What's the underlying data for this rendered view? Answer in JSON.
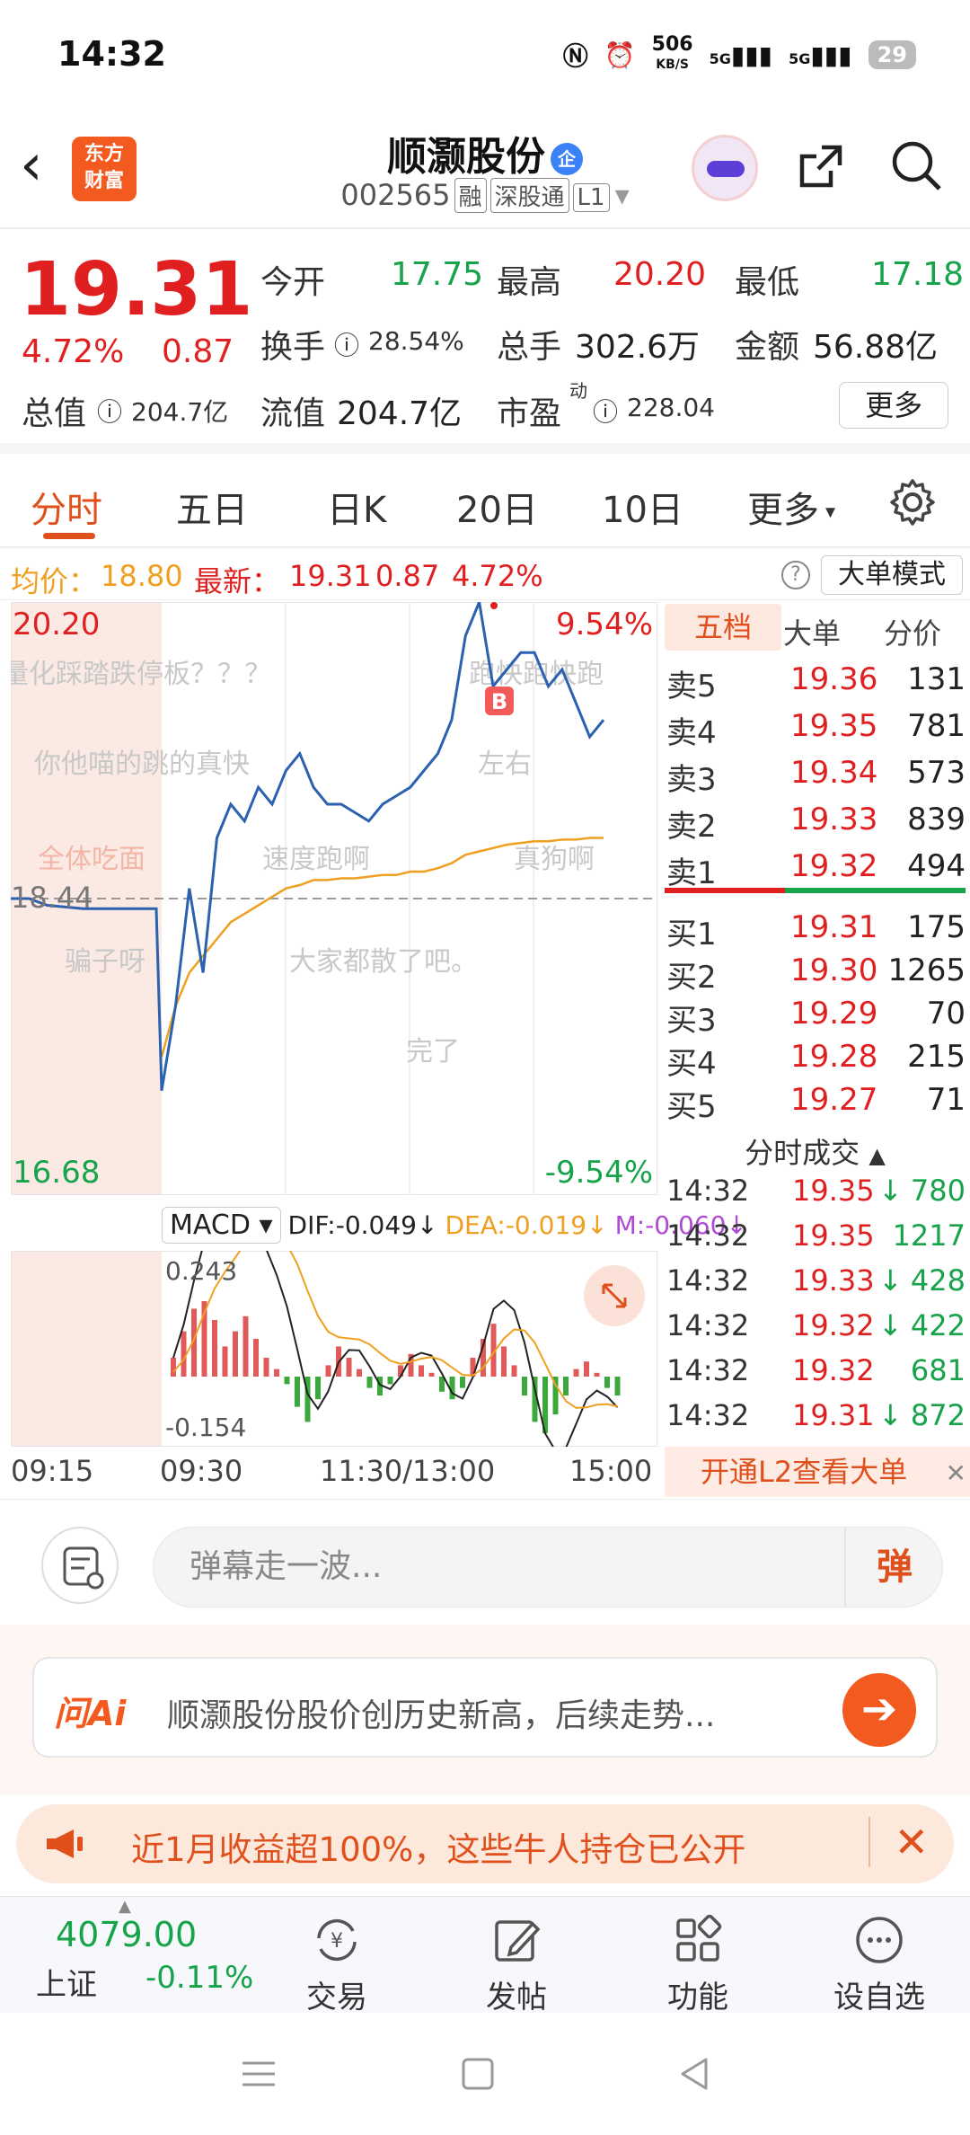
{
  "status_bar": {
    "time": "14:32",
    "net_speed": "506",
    "net_unit": "KB/S",
    "signal1": "5G",
    "signal2": "5G",
    "battery": "29"
  },
  "header": {
    "logo_line1": "东方",
    "logo_line2": "财富",
    "name": "顺灏股份",
    "name_badge": "企",
    "code": "002565",
    "tags": [
      "融",
      "深股通",
      "L1"
    ]
  },
  "quote": {
    "price": "19.31",
    "pct": "4.72%",
    "change": "0.87",
    "open_label": "今开",
    "open": "17.75",
    "high_label": "最高",
    "high": "20.20",
    "low_label": "最低",
    "low": "17.18",
    "turnover_label": "换手",
    "turnover": "28.54%",
    "volume_label": "总手",
    "volume": "302.6万",
    "amount_label": "金额",
    "amount": "56.88亿",
    "mktcap_label": "总值",
    "mktcap": "204.7亿",
    "float_label": "流值",
    "float": "204.7亿",
    "pe_label": "市盈",
    "pe_sup": "动",
    "pe": "228.04",
    "more_label": "更多"
  },
  "tabs": [
    "分时",
    "五日",
    "日K",
    "20日",
    "10日",
    "更多"
  ],
  "avg_line": {
    "avg_label": "均价：",
    "avg": "18.80",
    "latest_label": "最新：",
    "latest": "19.31",
    "latest_chg": "0.87",
    "latest_pct": "4.72%",
    "big_order_label": "大单模式"
  },
  "chart_data": {
    "type": "line",
    "title": "",
    "x_axis_labels": [
      "09:15",
      "09:30",
      "11:30/13:00",
      "15:00"
    ],
    "y_top_label": "20.20",
    "y_mid_label": "18.44",
    "y_bottom_label": "16.68",
    "pct_top_label": "9.54%",
    "pct_bottom_label": "-9.54%",
    "ylim": [
      16.68,
      20.2
    ],
    "series": [
      {
        "name": "price",
        "color": "#2b62b0",
        "values": [
          18.44,
          18.44,
          18.4,
          18.39,
          18.38,
          18.38,
          18.38,
          18.38,
          18.38,
          17.3,
          17.8,
          18.5,
          18.0,
          18.8,
          19.0,
          18.9,
          19.1,
          19.0,
          19.2,
          19.3,
          19.1,
          19.0,
          19.0,
          18.95,
          18.9,
          19.0,
          19.05,
          19.1,
          19.2,
          19.3,
          19.5,
          20.0,
          20.2,
          19.7,
          19.8,
          19.9,
          19.9,
          19.7,
          19.8,
          19.6,
          19.4,
          19.5
        ]
      },
      {
        "name": "avg",
        "color": "#f0a020",
        "values": [
          null,
          null,
          null,
          null,
          null,
          null,
          null,
          null,
          null,
          17.5,
          17.8,
          18.0,
          18.1,
          18.2,
          18.3,
          18.35,
          18.4,
          18.45,
          18.5,
          18.52,
          18.55,
          18.55,
          18.56,
          18.56,
          18.57,
          18.58,
          18.58,
          18.6,
          18.6,
          18.62,
          18.65,
          18.7,
          18.72,
          18.74,
          18.76,
          18.77,
          18.78,
          18.78,
          18.79,
          18.79,
          18.8,
          18.8
        ]
      }
    ]
  },
  "macd": {
    "selector": "MACD",
    "dif_label": "DIF:",
    "dif": "-0.049↓",
    "dea_label": "DEA:",
    "dea": "-0.019↓",
    "m_label": "M:",
    "m": "-0.060↓",
    "top": "0.243",
    "bottom": "-0.154",
    "histogram": [
      0.05,
      0.12,
      0.18,
      0.2,
      0.15,
      0.08,
      0.12,
      0.16,
      0.1,
      0.05,
      0.02,
      -0.02,
      -0.08,
      -0.12,
      -0.06,
      0.03,
      0.08,
      0.05,
      0.02,
      -0.03,
      -0.05,
      -0.02,
      0.03,
      0.06,
      0.03,
      0.01,
      -0.04,
      -0.06,
      -0.03,
      0.05,
      0.1,
      0.14,
      0.08,
      0.03,
      -0.05,
      -0.12,
      -0.15,
      -0.1,
      -0.05,
      0.02,
      0.04,
      0.01,
      -0.03,
      -0.05
    ]
  },
  "order_book": {
    "tabs": [
      "五档",
      "大单",
      "分价"
    ],
    "asks": [
      {
        "label": "卖5",
        "price": "19.36",
        "vol": "131"
      },
      {
        "label": "卖4",
        "price": "19.35",
        "vol": "781"
      },
      {
        "label": "卖3",
        "price": "19.34",
        "vol": "573"
      },
      {
        "label": "卖2",
        "price": "19.33",
        "vol": "839"
      },
      {
        "label": "卖1",
        "price": "19.32",
        "vol": "494"
      }
    ],
    "bids": [
      {
        "label": "买1",
        "price": "19.31",
        "vol": "175"
      },
      {
        "label": "买2",
        "price": "19.30",
        "vol": "1265"
      },
      {
        "label": "买3",
        "price": "19.29",
        "vol": "70"
      },
      {
        "label": "买4",
        "price": "19.28",
        "vol": "215"
      },
      {
        "label": "买5",
        "price": "19.27",
        "vol": "71"
      }
    ],
    "ticks_title": "分时成交",
    "ticks": [
      {
        "time": "14:32",
        "price": "19.35",
        "vol": "780",
        "arrow": "↓"
      },
      {
        "time": "14:32",
        "price": "19.35",
        "vol": "1217",
        "arrow": ""
      },
      {
        "time": "14:32",
        "price": "19.33",
        "vol": "428",
        "arrow": "↓"
      },
      {
        "time": "14:32",
        "price": "19.32",
        "vol": "422",
        "arrow": "↓"
      },
      {
        "time": "14:32",
        "price": "19.32",
        "vol": "681",
        "arrow": ""
      },
      {
        "time": "14:32",
        "price": "19.31",
        "vol": "872",
        "arrow": "↓"
      }
    ],
    "l2_banner": "开通L2查看大单"
  },
  "danmaku_comments": [
    "量化踩踏跌停板？？？",
    "你他喵的跳的真快",
    "左右",
    "全体吃面",
    "速度跑啊",
    "真狗啊",
    "骗子呀",
    "大家都散了吧。",
    "完了",
    "跑快跑快跑"
  ],
  "danmaku_input": {
    "placeholder": "弹幕走一波...",
    "send_label": "弹"
  },
  "ai_box": {
    "logo": "问Ai",
    "text": "顺灏股份股价创历史新高，后续走势..."
  },
  "promo": {
    "text": "近1月收益超100%，这些牛人持仓已公开"
  },
  "bottom_nav": {
    "index_value": "4079.00",
    "index_name": "上证",
    "index_pct": "-0.11%",
    "items": [
      "交易",
      "发帖",
      "功能",
      "设自选"
    ]
  },
  "colors": {
    "up": "#e02020",
    "down": "#16a34a",
    "accent": "#e0501c",
    "price_line": "#2b62b0",
    "avg_line": "#f0a020"
  }
}
